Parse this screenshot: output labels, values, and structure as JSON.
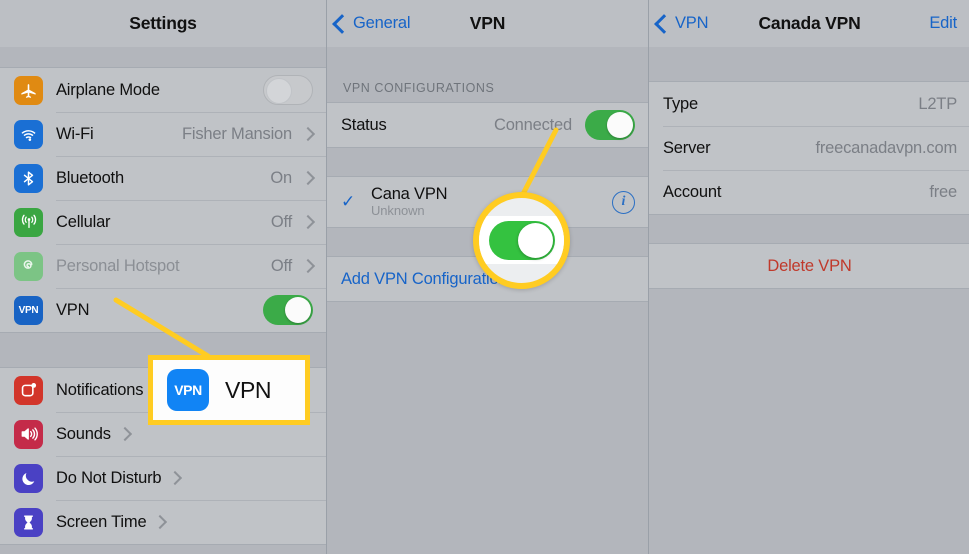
{
  "colors": {
    "accent_blue": "#1764c8",
    "highlight_yellow": "#ffcc22",
    "toggle_green": "#3bab48",
    "danger_red": "#c0392b",
    "panel_bg": "#b3b6bc",
    "row_bg": "#c0c3c7"
  },
  "left_panel": {
    "title": "Settings",
    "group1": [
      {
        "icon": "airplane-icon",
        "icon_color": "#e08a12",
        "label": "Airplane Mode",
        "control": "toggle",
        "toggle_on": false
      },
      {
        "icon": "wifi-icon",
        "icon_color": "#1a6fd4",
        "label": "Wi-Fi",
        "value": "Fisher Mansion",
        "control": "chevron"
      },
      {
        "icon": "bluetooth-icon",
        "icon_color": "#1a6fd4",
        "label": "Bluetooth",
        "value": "On",
        "control": "chevron"
      },
      {
        "icon": "cellular-icon",
        "icon_color": "#3aa642",
        "label": "Cellular",
        "value": "Off",
        "control": "chevron"
      },
      {
        "icon": "personal-hotspot-icon",
        "icon_color": "#7cc485",
        "label": "Personal Hotspot",
        "value": "Off",
        "control": "chevron",
        "dimmed": true
      },
      {
        "icon": "vpn-icon",
        "icon_color": "#1863c4",
        "label": "VPN",
        "control": "toggle",
        "toggle_on": true
      }
    ],
    "group2": [
      {
        "icon": "notifications-icon",
        "icon_color": "#d2352a",
        "label": "Notifications",
        "control": "chevron"
      },
      {
        "icon": "sounds-icon",
        "icon_color": "#c42b49",
        "label": "Sounds",
        "control": "chevron"
      },
      {
        "icon": "do-not-disturb-icon",
        "icon_color": "#4a41c4",
        "label": "Do Not Disturb",
        "control": "chevron"
      },
      {
        "icon": "screen-time-icon",
        "icon_color": "#4a41c4",
        "label": "Screen Time",
        "control": "chevron"
      }
    ]
  },
  "mid_panel": {
    "back_label": "General",
    "title": "VPN",
    "section_header": "VPN CONFIGURATIONS",
    "status_row": {
      "label": "Status",
      "value": "Connected",
      "toggle_on": true
    },
    "config": {
      "name": "Cana VPN",
      "subtitle": "Unknown",
      "selected": true,
      "info_glyph": "i"
    },
    "add_link": "Add VPN Configuration..."
  },
  "right_panel": {
    "back_label": "VPN",
    "title": "Canada VPN",
    "edit_label": "Edit",
    "details": [
      {
        "label": "Type",
        "value": "L2TP"
      },
      {
        "label": "Server",
        "value": "freecanadavpn.com"
      },
      {
        "label": "Account",
        "value": "free"
      }
    ],
    "delete_label": "Delete VPN"
  },
  "annotations": {
    "callout_vpn": {
      "icon_text": "VPN",
      "label": "VPN"
    },
    "magnifier_toggle": {
      "target": "vpn-status-toggle",
      "state_on": true
    }
  }
}
